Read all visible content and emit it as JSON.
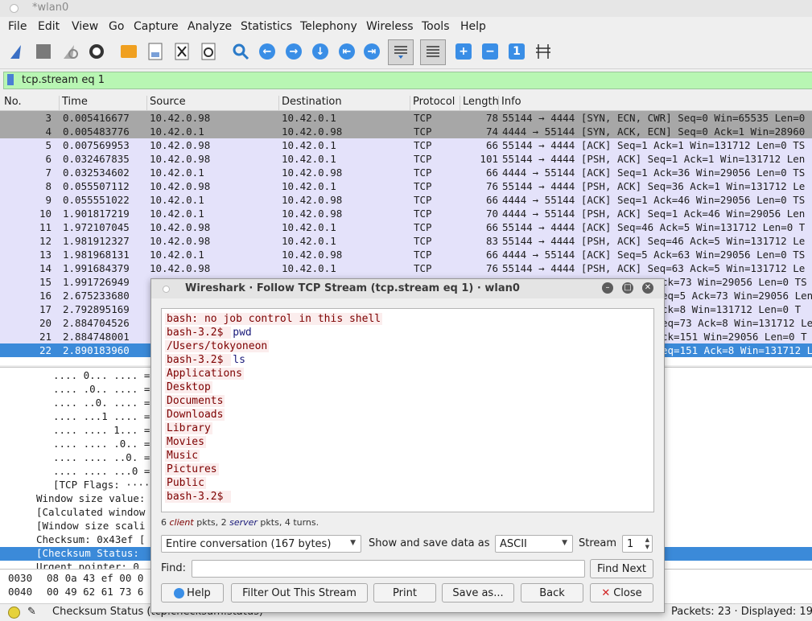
{
  "window": {
    "title": "*wlan0"
  },
  "menu": [
    "File",
    "Edit",
    "View",
    "Go",
    "Capture",
    "Analyze",
    "Statistics",
    "Telephony",
    "Wireless",
    "Tools",
    "Help"
  ],
  "toolbar": {
    "icons": [
      "shark-fin-start-icon",
      "stop-capture-icon",
      "restart-capture-icon",
      "capture-options-icon",
      "open-file-icon",
      "save-file-icon",
      "close-file-icon",
      "reload-file-icon",
      "find-packet-icon",
      "go-back-icon",
      "go-forward-icon",
      "go-to-packet-icon",
      "first-packet-icon",
      "last-packet-icon",
      "autoscroll-icon",
      "colorize-icon",
      "zoom-in-icon",
      "zoom-out-icon",
      "normal-size-icon",
      "resize-columns-icon"
    ]
  },
  "filter": {
    "value": "tcp.stream eq 1"
  },
  "packet_list": {
    "columns": [
      "No.",
      "Time",
      "Source",
      "Destination",
      "Protocol",
      "Length",
      "Info"
    ],
    "rows": [
      {
        "no": "3",
        "time": "0.005416677",
        "src": "10.42.0.98",
        "dst": "10.42.0.1",
        "proto": "TCP",
        "len": "78",
        "info": "55144 → 4444 [SYN, ECN, CWR] Seq=0 Win=65535 Len=0"
      },
      {
        "no": "4",
        "time": "0.005483776",
        "src": "10.42.0.1",
        "dst": "10.42.0.98",
        "proto": "TCP",
        "len": "74",
        "info": "4444 → 55144 [SYN, ACK, ECN] Seq=0 Ack=1 Win=28960"
      },
      {
        "no": "5",
        "time": "0.007569953",
        "src": "10.42.0.98",
        "dst": "10.42.0.1",
        "proto": "TCP",
        "len": "66",
        "info": "55144 → 4444 [ACK] Seq=1 Ack=1 Win=131712 Len=0 TS"
      },
      {
        "no": "6",
        "time": "0.032467835",
        "src": "10.42.0.98",
        "dst": "10.42.0.1",
        "proto": "TCP",
        "len": "101",
        "info": "55144 → 4444 [PSH, ACK] Seq=1 Ack=1 Win=131712 Len"
      },
      {
        "no": "7",
        "time": "0.032534602",
        "src": "10.42.0.1",
        "dst": "10.42.0.98",
        "proto": "TCP",
        "len": "66",
        "info": "4444 → 55144 [ACK] Seq=1 Ack=36 Win=29056 Len=0 TS"
      },
      {
        "no": "8",
        "time": "0.055507112",
        "src": "10.42.0.98",
        "dst": "10.42.0.1",
        "proto": "TCP",
        "len": "76",
        "info": "55144 → 4444 [PSH, ACK] Seq=36 Ack=1 Win=131712 Le"
      },
      {
        "no": "9",
        "time": "0.055551022",
        "src": "10.42.0.1",
        "dst": "10.42.0.98",
        "proto": "TCP",
        "len": "66",
        "info": "4444 → 55144 [ACK] Seq=1 Ack=46 Win=29056 Len=0 TS"
      },
      {
        "no": "10",
        "time": "1.901817219",
        "src": "10.42.0.1",
        "dst": "10.42.0.98",
        "proto": "TCP",
        "len": "70",
        "info": "4444 → 55144 [PSH, ACK] Seq=1 Ack=46 Win=29056 Len"
      },
      {
        "no": "11",
        "time": "1.972107045",
        "src": "10.42.0.98",
        "dst": "10.42.0.1",
        "proto": "TCP",
        "len": "66",
        "info": "55144 → 4444 [ACK] Seq=46 Ack=5 Win=131712 Len=0 T"
      },
      {
        "no": "12",
        "time": "1.981912327",
        "src": "10.42.0.98",
        "dst": "10.42.0.1",
        "proto": "TCP",
        "len": "83",
        "info": "55144 → 4444 [PSH, ACK] Seq=46 Ack=5 Win=131712 Le"
      },
      {
        "no": "13",
        "time": "1.981968131",
        "src": "10.42.0.1",
        "dst": "10.42.0.98",
        "proto": "TCP",
        "len": "66",
        "info": "4444 → 55144 [ACK] Seq=5 Ack=63 Win=29056 Len=0 TS"
      },
      {
        "no": "14",
        "time": "1.991684379",
        "src": "10.42.0.98",
        "dst": "10.42.0.1",
        "proto": "TCP",
        "len": "76",
        "info": "55144 → 4444 [PSH, ACK] Seq=63 Ack=5 Win=131712 Le"
      },
      {
        "no": "15",
        "time": "1.991726949",
        "src": "",
        "dst": "",
        "proto": "",
        "len": "",
        "info": "ck=73 Win=29056 Len=0 TS"
      },
      {
        "no": "16",
        "time": "2.675233680",
        "src": "",
        "dst": "",
        "proto": "",
        "len": "",
        "info": "eq=5 Ack=73 Win=29056 Len"
      },
      {
        "no": "17",
        "time": "2.792895169",
        "src": "",
        "dst": "",
        "proto": "",
        "len": "",
        "info": "ck=8 Win=131712 Len=0 T"
      },
      {
        "no": "20",
        "time": "2.884704526",
        "src": "",
        "dst": "",
        "proto": "",
        "len": "",
        "info": "eq=73 Ack=8 Win=131712 Le"
      },
      {
        "no": "21",
        "time": "2.884748001",
        "src": "",
        "dst": "",
        "proto": "",
        "len": "",
        "info": "ck=151 Win=29056 Len=0 T"
      },
      {
        "no": "22",
        "time": "2.890183960",
        "src": "",
        "dst": "",
        "proto": "",
        "len": "",
        "info": "eq=151 Ack=8 Win=131712 L"
      }
    ]
  },
  "details": {
    "lines": [
      ".... 0... .... =",
      ".... .0.. .... =",
      ".... ..0. .... =",
      ".... ...1 .... =",
      ".... .... 1... =",
      ".... .... .0.. =",
      ".... .... ..0. =",
      ".... .... ...0 =",
      "[TCP Flags: ····",
      "Window size value:",
      "[Calculated window",
      "[Window size scali",
      "Checksum: 0x43ef [",
      "[Checksum Status:",
      "Urgent pointer: 0"
    ]
  },
  "bytes": {
    "rows": [
      {
        "offset": "0030",
        "hex": "08 0a 43 ef 00 0"
      },
      {
        "offset": "0040",
        "hex": "00 49 62 61 73 6"
      }
    ]
  },
  "statusbar": {
    "field": "Checksum Status (tcp.checksum.status)",
    "packets": "Packets: 23 · Displayed: 19"
  },
  "dialog": {
    "title": "Wireshark · Follow TCP Stream (tcp.stream eq 1) · wlan0",
    "stream_lines": [
      {
        "text": "bash: no job control in this shell",
        "dir": "client"
      },
      {
        "text": "bash-3.2$ ",
        "dir": "client",
        "extra": "pwd"
      },
      {
        "text": "/Users/tokyoneon",
        "dir": "client"
      },
      {
        "text": "bash-3.2$ ",
        "dir": "client",
        "extra": "ls"
      },
      {
        "text": "Applications",
        "dir": "client"
      },
      {
        "text": "Desktop",
        "dir": "client"
      },
      {
        "text": "Documents",
        "dir": "client"
      },
      {
        "text": "Downloads",
        "dir": "client"
      },
      {
        "text": "Library",
        "dir": "client"
      },
      {
        "text": "Movies",
        "dir": "client"
      },
      {
        "text": "Music",
        "dir": "client"
      },
      {
        "text": "Pictures",
        "dir": "client"
      },
      {
        "text": "Public",
        "dir": "client"
      },
      {
        "text": "bash-3.2$ ",
        "dir": "client"
      }
    ],
    "summary": {
      "p1": "6 ",
      "client": "client",
      "p2": " pkts, 2 ",
      "server": "server",
      "p3": " pkts, 4 turns."
    },
    "conversation": "Entire conversation (167 bytes)",
    "show_label": "Show and save data as",
    "format": "ASCII",
    "stream_label": "Stream",
    "stream_value": "1",
    "find_label": "Find:",
    "find_value": "",
    "find_next": "Find Next",
    "buttons": {
      "help": "Help",
      "filter_out": "Filter Out This Stream",
      "print": "Print",
      "save_as": "Save as...",
      "back": "Back",
      "close": "Close"
    }
  },
  "colors": {
    "accent": "#3a8ee6",
    "filter_bg": "#b8f6b3",
    "selected_row": "#3b8ad9",
    "row_bg": "#e4e2fa",
    "client_text": "#7d0000",
    "client_bg": "#fbeded",
    "server_text": "#1a1a7a"
  }
}
